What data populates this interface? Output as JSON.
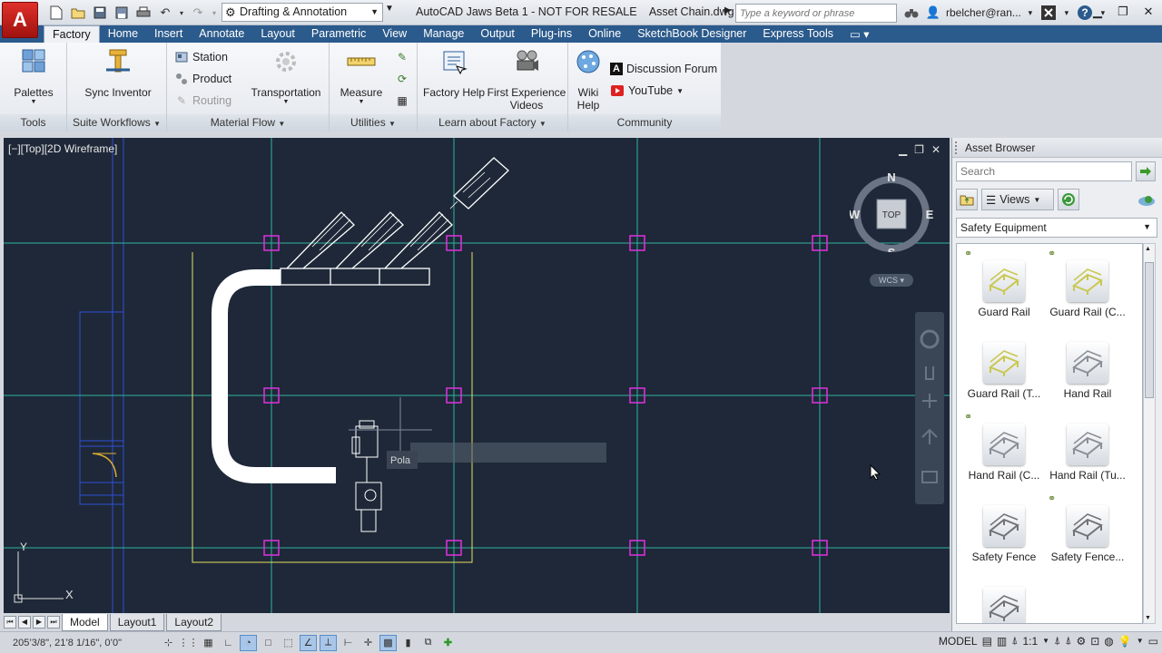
{
  "app": {
    "title": "AutoCAD Jaws Beta 1 - NOT FOR RESALE",
    "file": "Asset Chain.dwg",
    "logo_letter": "A",
    "workspace": "Drafting & Annotation",
    "search_placeholder": "Type a keyword or phrase",
    "user": "rbelcher@ran..."
  },
  "ribbon_tabs": [
    "Factory",
    "Home",
    "Insert",
    "Annotate",
    "Layout",
    "Parametric",
    "View",
    "Manage",
    "Output",
    "Plug-ins",
    "Online",
    "SketchBook Designer",
    "Express Tools"
  ],
  "ribbon": {
    "tools": {
      "title": "Tools",
      "palettes": "Palettes"
    },
    "suite": {
      "title": "Suite Workflows",
      "sync": "Sync Inventor"
    },
    "material": {
      "title": "Material Flow",
      "station": "Station",
      "product": "Product",
      "routing": "Routing",
      "transportation": "Transportation"
    },
    "utilities": {
      "title": "Utilities",
      "measure": "Measure"
    },
    "learn": {
      "title": "Learn about Factory",
      "help": "Factory Help",
      "first_exp_1": "First Experience",
      "first_exp_2": "Videos"
    },
    "community": {
      "title": "Community",
      "wiki_1": "Wiki",
      "wiki_2": "Help",
      "forum": "Discussion Forum",
      "youtube": "YouTube"
    }
  },
  "viewport": {
    "label": "[−][Top][2D Wireframe]",
    "compass": {
      "n": "N",
      "s": "S",
      "e": "E",
      "w": "W",
      "top": "TOP"
    },
    "wcs": "WCS",
    "tooltip": "Pola",
    "ucs_y": "Y",
    "ucs_x": "X"
  },
  "layout_tabs": [
    "Model",
    "Layout1",
    "Layout2"
  ],
  "status": {
    "coords": "205’3/8\", 21’8 1/16\", 0’0\"",
    "mode": "MODEL",
    "scale": "1:1"
  },
  "asset_browser": {
    "title": "Asset Browser",
    "search_placeholder": "Search",
    "views_label": "Views",
    "category": "Safety Equipment",
    "assets": [
      {
        "label": "Guard Rail",
        "faded": "Be...",
        "badge": true,
        "color": "#c9c850"
      },
      {
        "label": "Guard Rail (C...",
        "badge": true,
        "color": "#c9c850"
      },
      {
        "label": "Guard Rail (T...",
        "badge": false,
        "color": "#c9c850"
      },
      {
        "label": "Hand Rail",
        "faded": "Sp...",
        "badge": false,
        "color": "#8a9098"
      },
      {
        "label": "Hand Rail (C...",
        "badge": true,
        "color": "#8a9098"
      },
      {
        "label": "Hand Rail (Tu...",
        "badge": false,
        "color": "#8a9098"
      },
      {
        "label": "Safety Fence",
        "badge": false,
        "color": "#707478"
      },
      {
        "label": "Safety Fence...",
        "badge": true,
        "color": "#707478"
      },
      {
        "label": "",
        "badge": false,
        "color": "#707478"
      }
    ]
  }
}
